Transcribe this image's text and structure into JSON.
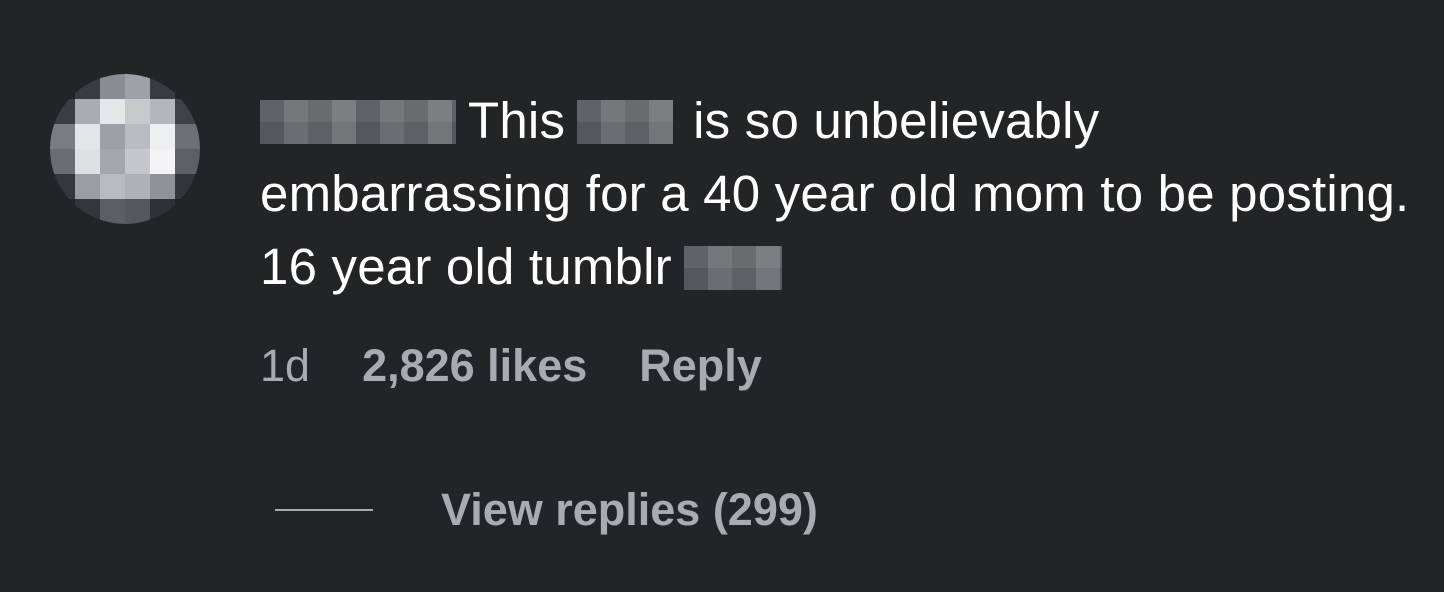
{
  "comment": {
    "text_part_1": "This",
    "text_part_2": "is so unbelievably embarrassing for a 40 year old mom to be posting. 16 year old tumblr",
    "age": "1d",
    "likes": "2,826 likes",
    "reply_label": "Reply",
    "view_replies_label": "View replies (299)"
  },
  "colors": {
    "background": "#232428",
    "primary_text": "#ffffff",
    "secondary_text": "#a8abb1"
  }
}
